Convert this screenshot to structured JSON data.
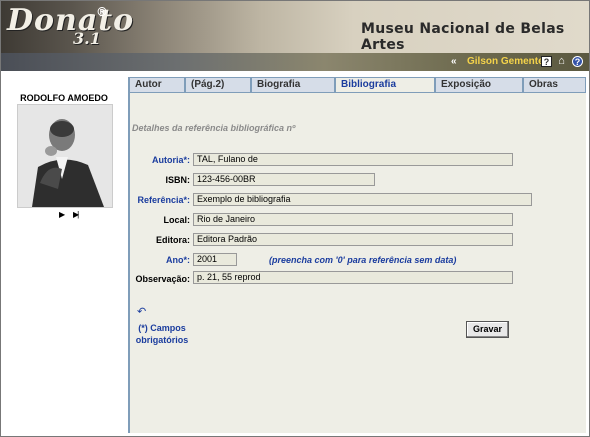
{
  "app": {
    "logo_text": "Donato",
    "logo_mark": "®",
    "logo_version": "3.1",
    "museum_name": "Museu Nacional de Belas Artes"
  },
  "userbar": {
    "back_glyph": "«",
    "username": "Gilson Gemente",
    "icons": [
      "help-icon",
      "home-icon",
      "info-icon"
    ]
  },
  "sidebar": {
    "person_name": "RODOLFO AMOEDO",
    "photo_icon": "portrait-photo",
    "nav_next": "▶",
    "nav_last": "▶|"
  },
  "tabs": [
    {
      "label": "Autor",
      "active": false
    },
    {
      "label": "(Pág.2)",
      "active": false
    },
    {
      "label": "Biografia",
      "active": false
    },
    {
      "label": "Bibliografia",
      "active": true
    },
    {
      "label": "Exposição",
      "active": false
    },
    {
      "label": "Obras",
      "active": false
    }
  ],
  "form": {
    "title": "Detalhes da referência bibliográfica nº",
    "fields": {
      "autoria": {
        "label": "Autoria*:",
        "value": "TAL, Fulano de"
      },
      "isbn": {
        "label": "ISBN:",
        "value": "123-456-00BR"
      },
      "referencia": {
        "label": "Referência*:",
        "value": "Exemplo de bibliografia"
      },
      "local": {
        "label": "Local:",
        "value": "Rio de Janeiro"
      },
      "editora": {
        "label": "Editora:",
        "value": "Editora Padrão"
      },
      "ano": {
        "label": "Ano*:",
        "value": "2001",
        "hint": "(preencha com '0' para referência sem data)"
      },
      "observacao": {
        "label": "Observação:",
        "value": "p. 21, 55 reprod"
      }
    },
    "required_note": "(*) Campos obrigatórios",
    "save_label": "Gravar",
    "undo_icon": "undo-icon"
  },
  "colors": {
    "accent_blue": "#1a3c9e",
    "username_yellow": "#f4d34a",
    "panel_bg": "#eeeee6",
    "field_bg": "#e9e9dc"
  }
}
